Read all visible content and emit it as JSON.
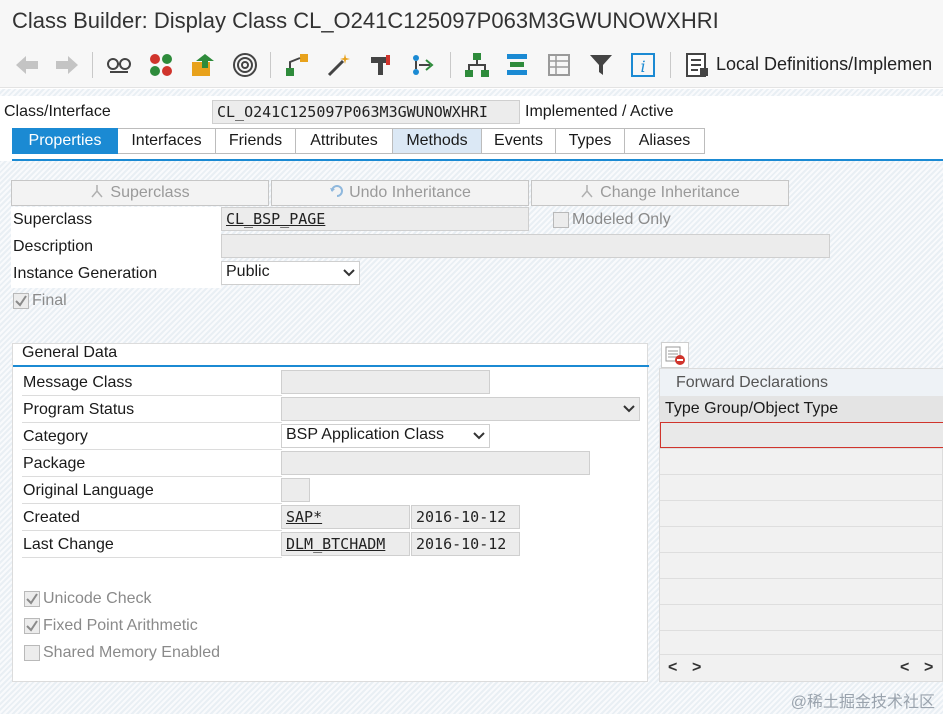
{
  "window": {
    "title": "Class Builder: Display Class CL_O241C125097P063M3GWUNOWXHRI"
  },
  "toolbar": {
    "icons": [
      "back-arrow-icon",
      "forward-arrow-icon",
      "glasses-icon",
      "object-list-icon",
      "upload-icon",
      "circle-target-icon",
      "hierarchy-icon",
      "magic-wand-icon",
      "tool-icon",
      "branch-icon",
      "tree-icon",
      "stack-icon",
      "grid-icon",
      "filter-icon",
      "info-icon",
      "document-icon"
    ],
    "local_definitions_label": "Local Definitions/Implemen"
  },
  "header": {
    "class_interface_label": "Class/Interface",
    "class_name": "CL_O241C125097P063M3GWUNOWXHRI",
    "status": "Implemented / Active"
  },
  "tabs": [
    {
      "label": "Properties",
      "state": "active"
    },
    {
      "label": "Interfaces",
      "state": "normal"
    },
    {
      "label": "Friends",
      "state": "normal"
    },
    {
      "label": "Attributes",
      "state": "normal"
    },
    {
      "label": "Methods",
      "state": "selected"
    },
    {
      "label": "Events",
      "state": "normal"
    },
    {
      "label": "Types",
      "state": "normal"
    },
    {
      "label": "Aliases",
      "state": "normal"
    }
  ],
  "buttons": {
    "superclass": "Superclass",
    "undo_inheritance": "Undo Inheritance",
    "change_inheritance": "Change Inheritance"
  },
  "properties": {
    "superclass_label": "Superclass",
    "superclass_value": "CL_BSP_PAGE",
    "modeled_only_label": "Modeled Only",
    "description_label": "Description",
    "description_value": "",
    "instance_generation_label": "Instance Generation",
    "instance_generation_value": "Public",
    "final_label": "Final"
  },
  "general_data": {
    "title": "General Data",
    "message_class_label": "Message Class",
    "message_class_value": "",
    "program_status_label": "Program Status",
    "program_status_value": "",
    "category_label": "Category",
    "category_value": "BSP Application Class",
    "package_label": "Package",
    "package_value": "",
    "original_language_label": "Original Language",
    "original_language_value": "",
    "created_label": "Created",
    "created_by": "SAP*",
    "created_date": "2016-10-12",
    "last_change_label": "Last Change",
    "last_change_by": "DLM_BTCHADM",
    "last_change_date": "2016-10-12",
    "unicode_check_label": "Unicode Check",
    "fixed_point_label": "Fixed Point Arithmetic",
    "shared_memory_label": "Shared Memory Enabled"
  },
  "forward_declarations": {
    "title": "Forward Declarations",
    "column_header": "Type Group/Object Type",
    "scroll_left": "<",
    "scroll_right": ">"
  },
  "watermark": "@稀土掘金技术社区",
  "colors": {
    "accent": "#1b8ad3",
    "tab_selected": "#dbe8f5"
  }
}
